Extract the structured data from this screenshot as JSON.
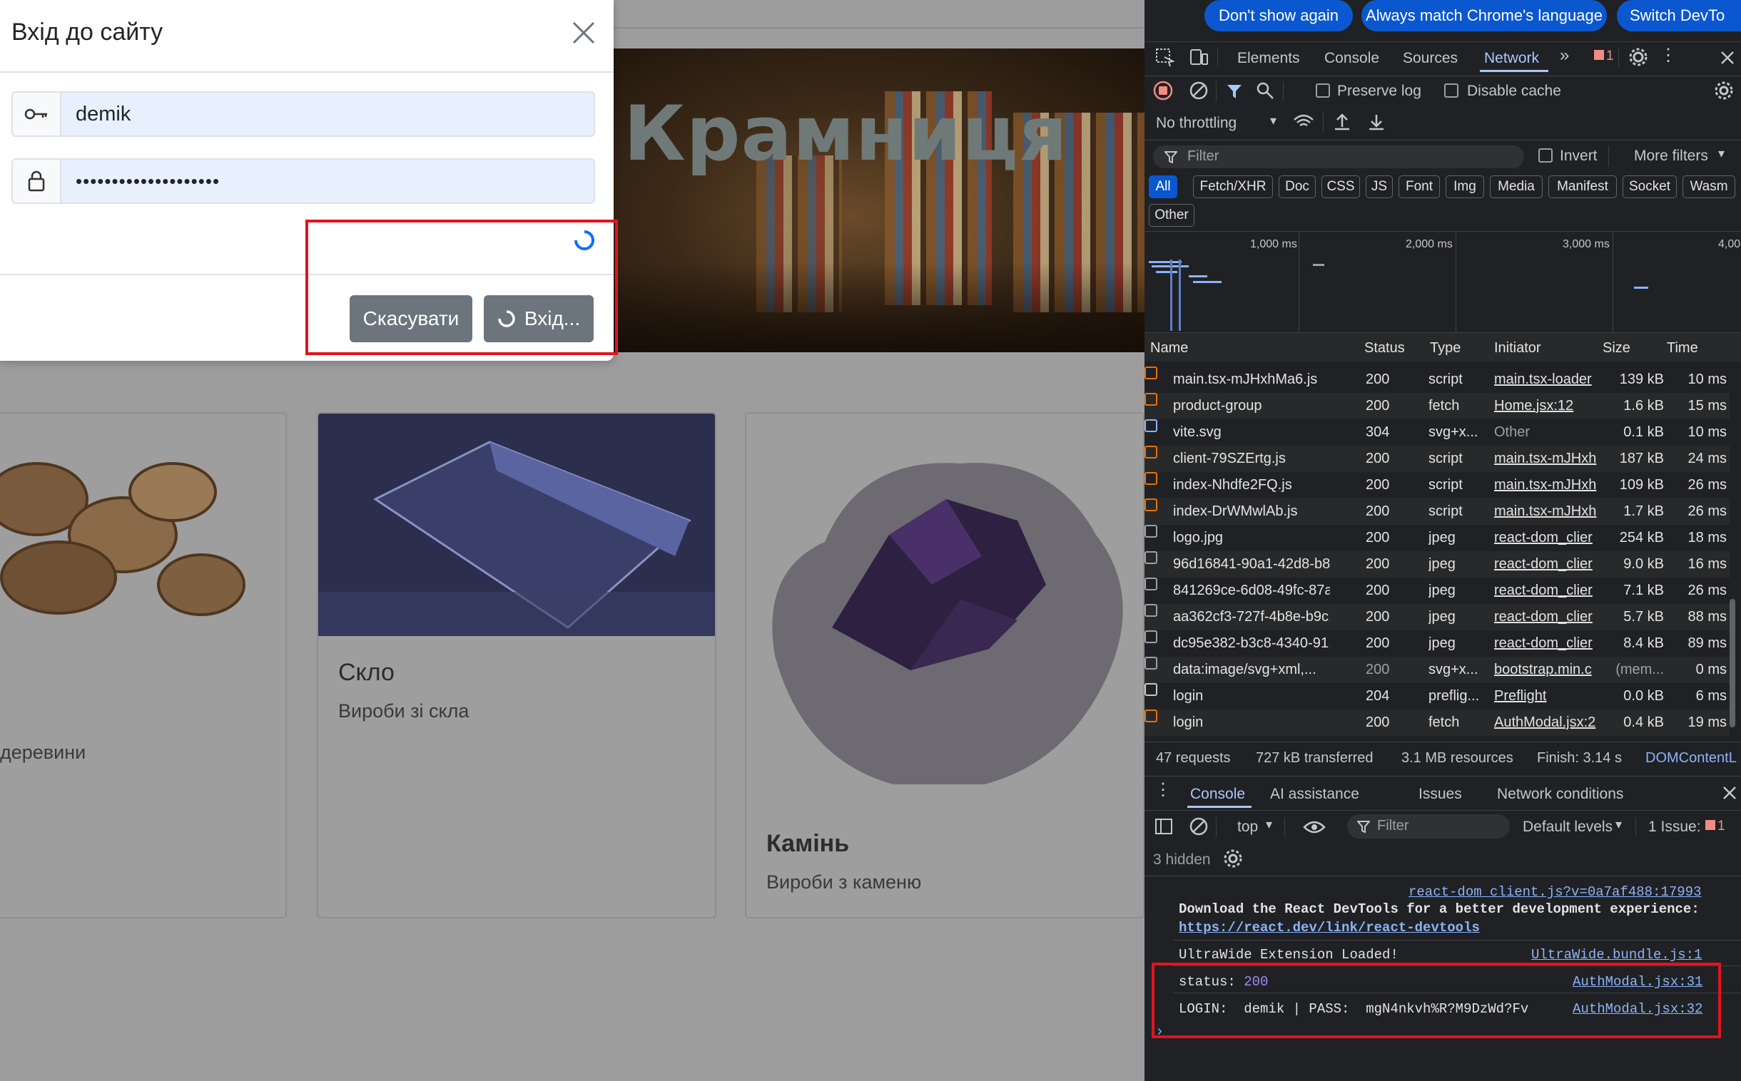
{
  "modal": {
    "title": "Вхід до сайту",
    "username": "demik",
    "password": "••••••••••••••••••••",
    "cancel_label": "Скасувати",
    "submit_label": "Вхід..."
  },
  "page": {
    "banner_title": "Крамниця",
    "cards": [
      {
        "title": "",
        "desc": "деревини"
      },
      {
        "title": "Скло",
        "desc": "Вироби зі скла"
      },
      {
        "title": "Камінь",
        "desc": "Вироби з каменю"
      }
    ]
  },
  "devtools": {
    "promo": [
      "Don't show again",
      "Always match Chrome's language",
      "Switch DevTo"
    ],
    "tabs": [
      "Elements",
      "Console",
      "Sources",
      "Network"
    ],
    "issues_badge": "1",
    "preserve_log": "Preserve log",
    "disable_cache": "Disable cache",
    "throttling": "No throttling",
    "filter_placeholder": "Filter",
    "invert": "Invert",
    "more_filters": "More filters",
    "type_filters": [
      "All",
      "Fetch/XHR",
      "Doc",
      "CSS",
      "JS",
      "Font",
      "Img",
      "Media",
      "Manifest",
      "Socket",
      "Wasm",
      "Other"
    ],
    "timeline_ticks": [
      "1,000 ms",
      "2,000 ms",
      "3,000 ms",
      "4,00"
    ],
    "columns": [
      "Name",
      "Status",
      "Type",
      "Initiator",
      "Size",
      "Time"
    ],
    "rows": [
      {
        "name": "main.tsx-mJHxhMa6.js",
        "status": "200",
        "type": "script",
        "initiator": "main.tsx-loader",
        "size": "139 kB",
        "time": "10 ms",
        "icon": "js"
      },
      {
        "name": "product-group",
        "status": "200",
        "type": "fetch",
        "initiator": "Home.jsx:12",
        "size": "1.6 kB",
        "time": "15 ms",
        "icon": "fetch"
      },
      {
        "name": "vite.svg",
        "status": "304",
        "type": "svg+x...",
        "initiator": "Other",
        "size": "0.1 kB",
        "time": "10 ms",
        "icon": "svg"
      },
      {
        "name": "client-79SZErtg.js",
        "status": "200",
        "type": "script",
        "initiator": "main.tsx-mJHxh",
        "size": "187 kB",
        "time": "24 ms",
        "icon": "js"
      },
      {
        "name": "index-Nhdfe2FQ.js",
        "status": "200",
        "type": "script",
        "initiator": "main.tsx-mJHxh",
        "size": "109 kB",
        "time": "26 ms",
        "icon": "js"
      },
      {
        "name": "index-DrWMwlAb.js",
        "status": "200",
        "type": "script",
        "initiator": "main.tsx-mJHxh",
        "size": "1.7 kB",
        "time": "26 ms",
        "icon": "js"
      },
      {
        "name": "logo.jpg",
        "status": "200",
        "type": "jpeg",
        "initiator": "react-dom_clier",
        "size": "254 kB",
        "time": "18 ms",
        "icon": "img"
      },
      {
        "name": "96d16841-90a1-42d8-b8...",
        "status": "200",
        "type": "jpeg",
        "initiator": "react-dom_clier",
        "size": "9.0 kB",
        "time": "16 ms",
        "icon": "img"
      },
      {
        "name": "841269ce-6d08-49fc-87a...",
        "status": "200",
        "type": "jpeg",
        "initiator": "react-dom_clier",
        "size": "7.1 kB",
        "time": "26 ms",
        "icon": "img"
      },
      {
        "name": "aa362cf3-727f-4b8e-b9c...",
        "status": "200",
        "type": "jpeg",
        "initiator": "react-dom_clier",
        "size": "5.7 kB",
        "time": "88 ms",
        "icon": "img"
      },
      {
        "name": "dc95e382-b3c8-4340-91...",
        "status": "200",
        "type": "jpeg",
        "initiator": "react-dom_clier",
        "size": "8.4 kB",
        "time": "89 ms",
        "icon": "img"
      },
      {
        "name": "data:image/svg+xml,...",
        "status": "200",
        "type": "svg+x...",
        "initiator": "bootstrap.min.c",
        "size": "(mem...",
        "time": "0 ms",
        "icon": "x"
      },
      {
        "name": "login",
        "status": "204",
        "type": "preflig...",
        "initiator": "Preflight",
        "size": "0.0 kB",
        "time": "6 ms",
        "icon": "pre"
      },
      {
        "name": "login",
        "status": "200",
        "type": "fetch",
        "initiator": "AuthModal.jsx:2",
        "size": "0.4 kB",
        "time": "19 ms",
        "icon": "fetch"
      }
    ],
    "summary": [
      "47 requests",
      "727 kB transferred",
      "3.1 MB resources",
      "Finish: 3.14 s",
      "DOMContentL"
    ],
    "drawer_tabs": [
      "Console",
      "AI assistance",
      "Issues",
      "Network conditions"
    ],
    "context": "top",
    "console_filter": "Filter",
    "levels": "Default levels",
    "issue_count": "1 Issue:",
    "issue_badge": "1",
    "hidden": "3 hidden",
    "console": {
      "src1": "react-dom_client.js?v=0a7af488:17993",
      "msg1": "Download the React DevTools for a better development experience:",
      "msg1_link": "https://react.dev/link/react-devtools",
      "msg2": "UltraWide Extension Loaded!",
      "src2": "UltraWide.bundle.js:1",
      "status_label": "status:",
      "status_value": "200",
      "src3": "AuthModal.jsx:31",
      "login_line": "LOGIN:  demik | PASS:  mgN4nkvh%R?M9DzWd?Fv",
      "src4": "AuthModal.jsx:32"
    }
  }
}
